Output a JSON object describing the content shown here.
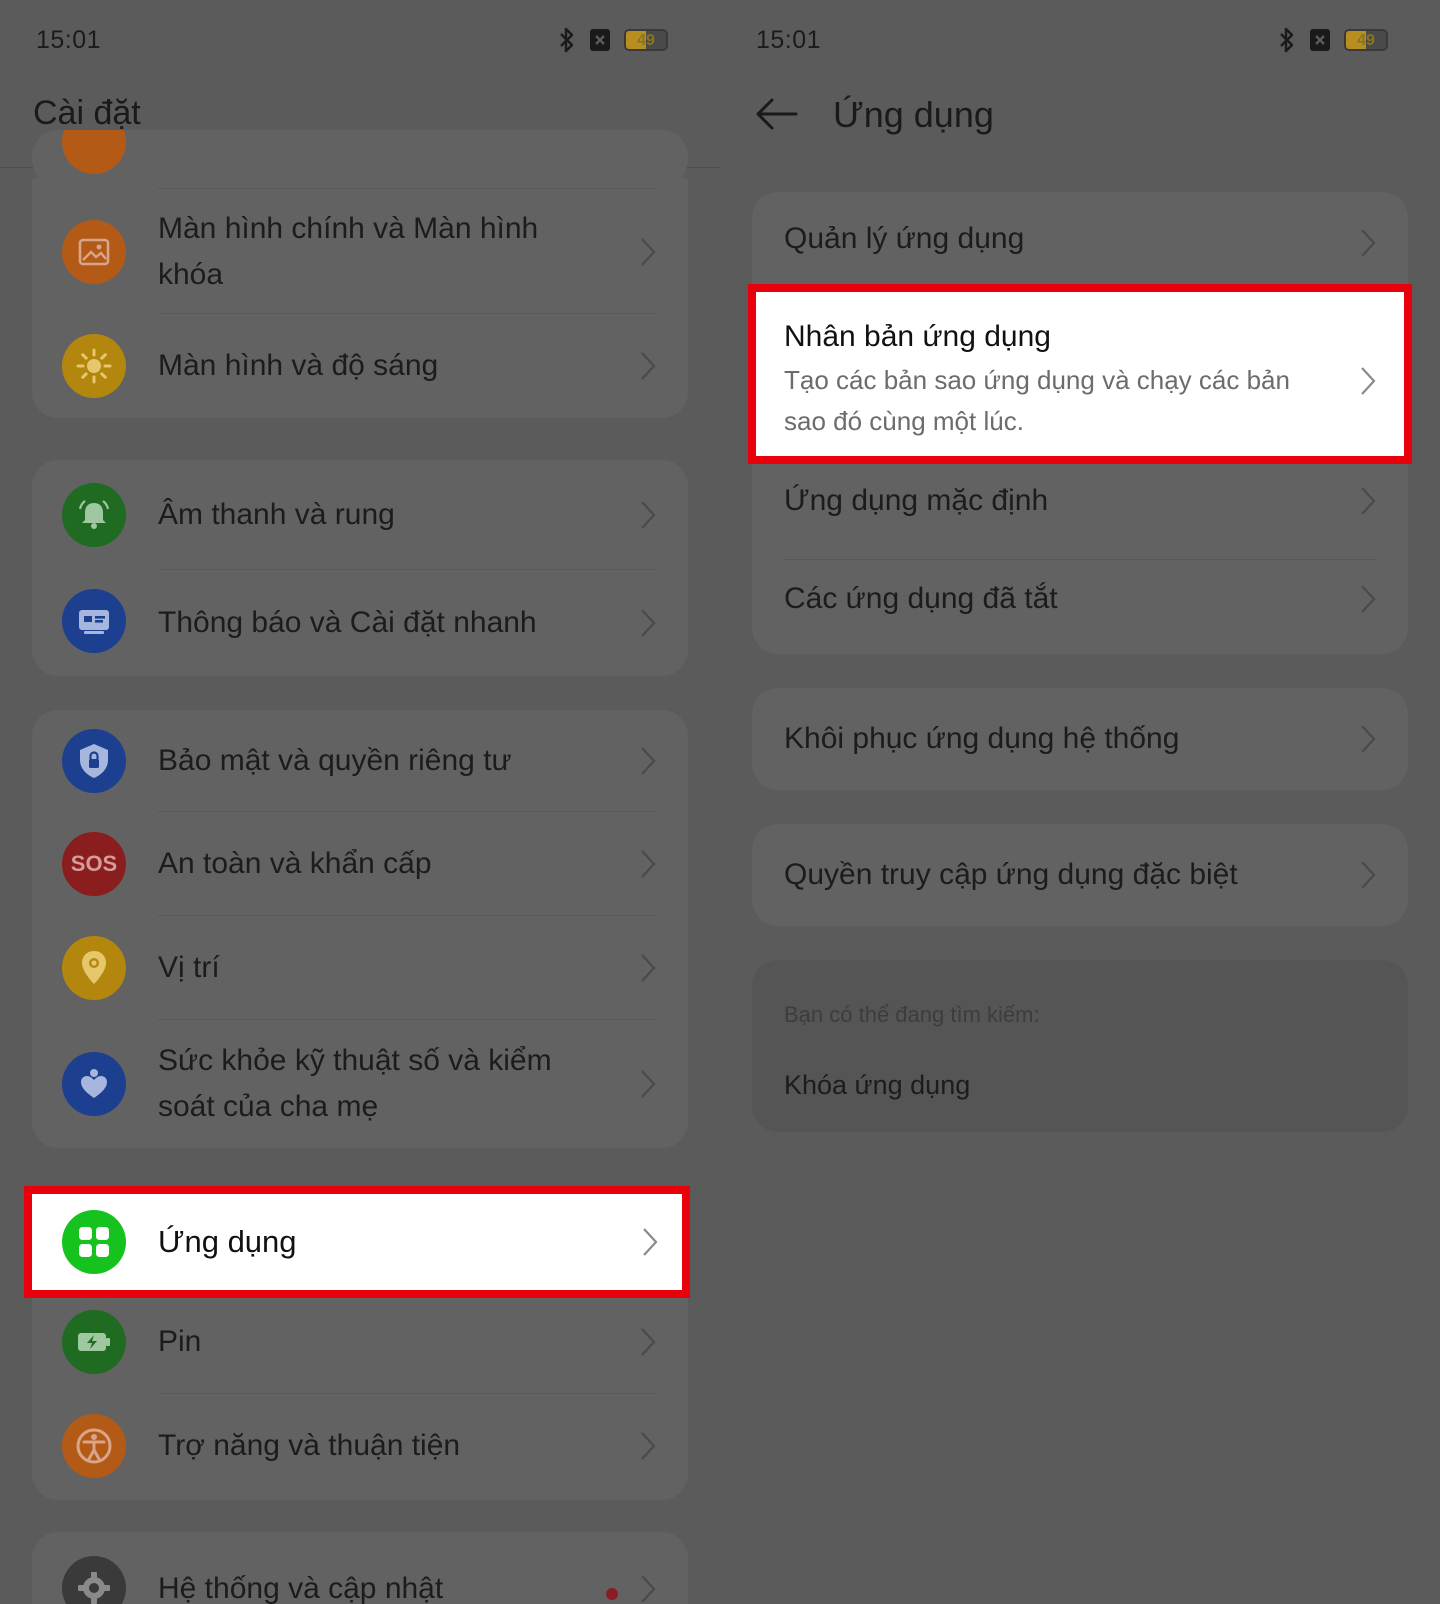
{
  "left": {
    "status": {
      "time": "15:01",
      "battery": "49",
      "battery_level": 0.49
    },
    "title": "Cài đặt",
    "groups": [
      {
        "items": [
          {
            "label": "Màn hình chính và Màn hình khóa",
            "icon": "wallpaper-icon",
            "color": "#b35a16"
          },
          {
            "label": "Màn hình và độ sáng",
            "icon": "sun-icon",
            "color": "#b3860d"
          }
        ]
      },
      {
        "items": [
          {
            "label": "Âm thanh và rung",
            "icon": "bell-icon",
            "color": "#1f6b22"
          },
          {
            "label": "Thông báo và Cài đặt nhanh",
            "icon": "notification-icon",
            "color": "#1d3f8f"
          }
        ]
      },
      {
        "items": [
          {
            "label": "Bảo mật và quyền riêng tư",
            "icon": "shield-lock-icon",
            "color": "#1d3f8f"
          },
          {
            "label": "An toàn và khẩn cấp",
            "icon": "sos-icon",
            "color": "#8a1d1d",
            "icon_text": "SOS"
          },
          {
            "label": "Vị trí",
            "icon": "location-pin-icon",
            "color": "#b3860d"
          },
          {
            "label": "Sức khỏe kỹ thuật số và kiểm soát của cha mẹ",
            "icon": "heart-person-icon",
            "color": "#1d3f8f"
          }
        ]
      },
      {
        "items": [
          {
            "label": "Ứng dụng",
            "icon": "apps-grid-icon",
            "color": "#16c21e",
            "highlighted": true
          },
          {
            "label": "Pin",
            "icon": "battery-icon",
            "color": "#1f6b22"
          },
          {
            "label": "Trợ năng và thuận tiện",
            "icon": "accessibility-icon",
            "color": "#b35a16"
          }
        ]
      },
      {
        "items": [
          {
            "label": "Hệ thống và cập nhật",
            "icon": "gear-icon",
            "color": "#3a3a3a",
            "badge": "red-dot"
          }
        ]
      }
    ]
  },
  "right": {
    "status": {
      "time": "15:01",
      "battery": "49",
      "battery_level": 0.49
    },
    "title": "Ứng dụng",
    "groups": [
      {
        "items": [
          {
            "label": "Quản lý ứng dụng"
          },
          {
            "label": "Nhân bản ứng dụng",
            "description": "Tạo các bản sao ứng dụng và chạy các bản sao đó cùng một lúc.",
            "highlighted": true
          },
          {
            "label": "Ứng dụng mặc định"
          },
          {
            "label": "Các ứng dụng đã tắt"
          }
        ]
      },
      {
        "items": [
          {
            "label": "Khôi phục ứng dụng hệ thống"
          }
        ]
      },
      {
        "items": [
          {
            "label": "Quyền truy cập ứng dụng đặc biệt"
          }
        ]
      }
    ],
    "search": {
      "hint": "Bạn có thể đang tìm kiếm:",
      "link": "Khóa ứng dụng"
    }
  },
  "colors": {
    "highlight_border": "#e8000a",
    "dim_background": "#5b5b5b"
  }
}
